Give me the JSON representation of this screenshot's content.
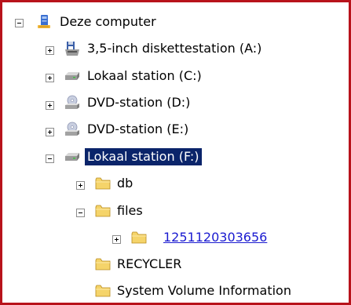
{
  "tree": {
    "root": {
      "label": "Deze computer",
      "icon": "computer-icon",
      "expanded": true
    },
    "drives": [
      {
        "label": "3,5-inch diskettestation (A:)",
        "icon": "floppy-drive-icon",
        "expanded": false
      },
      {
        "label": "Lokaal station (C:)",
        "icon": "hard-drive-icon",
        "expanded": false
      },
      {
        "label": "DVD-station (D:)",
        "icon": "dvd-drive-icon",
        "expanded": false
      },
      {
        "label": "DVD-station (E:)",
        "icon": "dvd-drive-icon",
        "expanded": false
      },
      {
        "label": "Lokaal station (F:)",
        "icon": "hard-drive-icon",
        "expanded": true,
        "selected": true
      }
    ],
    "folders": [
      {
        "label": "db",
        "icon": "folder-icon",
        "expanded": false
      },
      {
        "label": "files",
        "icon": "folder-icon",
        "expanded": true
      },
      {
        "label": "1251120303656",
        "icon": "folder-icon",
        "expanded": false,
        "link": true
      },
      {
        "label": "RECYCLER",
        "icon": "folder-icon"
      },
      {
        "label": "System Volume Information",
        "icon": "folder-icon"
      }
    ]
  },
  "colors": {
    "border": "#b8131b",
    "selection": "#0a246a",
    "link": "#1a1ad0",
    "folder": "#f5d46a"
  }
}
